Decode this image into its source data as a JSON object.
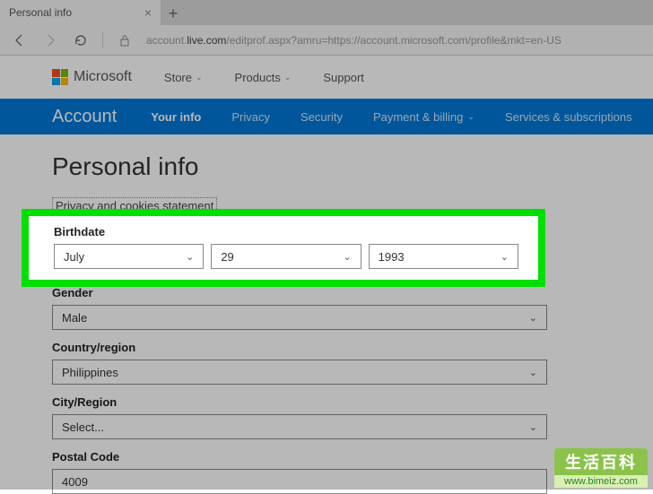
{
  "browser": {
    "tab_title": "Personal info",
    "url_pre": "account.",
    "url_bold": "live.com",
    "url_post": "/editprof.aspx?amru=https://account.microsoft.com/profile&mkt=en-US"
  },
  "ms_header": {
    "brand": "Microsoft",
    "nav": {
      "store": "Store",
      "products": "Products",
      "support": "Support"
    }
  },
  "account_nav": {
    "title": "Account",
    "your_info": "Your info",
    "privacy": "Privacy",
    "security": "Security",
    "payment": "Payment & billing",
    "services": "Services & subscriptions"
  },
  "form": {
    "page_title": "Personal info",
    "privacy_stmt": "Privacy and cookies statement",
    "birthdate_label": "Birthdate",
    "birthdate": {
      "month": "July",
      "day": "29",
      "year": "1993"
    },
    "gender_label": "Gender",
    "gender_value": "Male",
    "country_label": "Country/region",
    "country_value": "Philippines",
    "city_label": "City/Region",
    "city_value": "Select...",
    "postal_label": "Postal Code",
    "postal_value": "4009"
  },
  "watermark": {
    "top": "生活百科",
    "bot": "www.bimeiz.com"
  }
}
